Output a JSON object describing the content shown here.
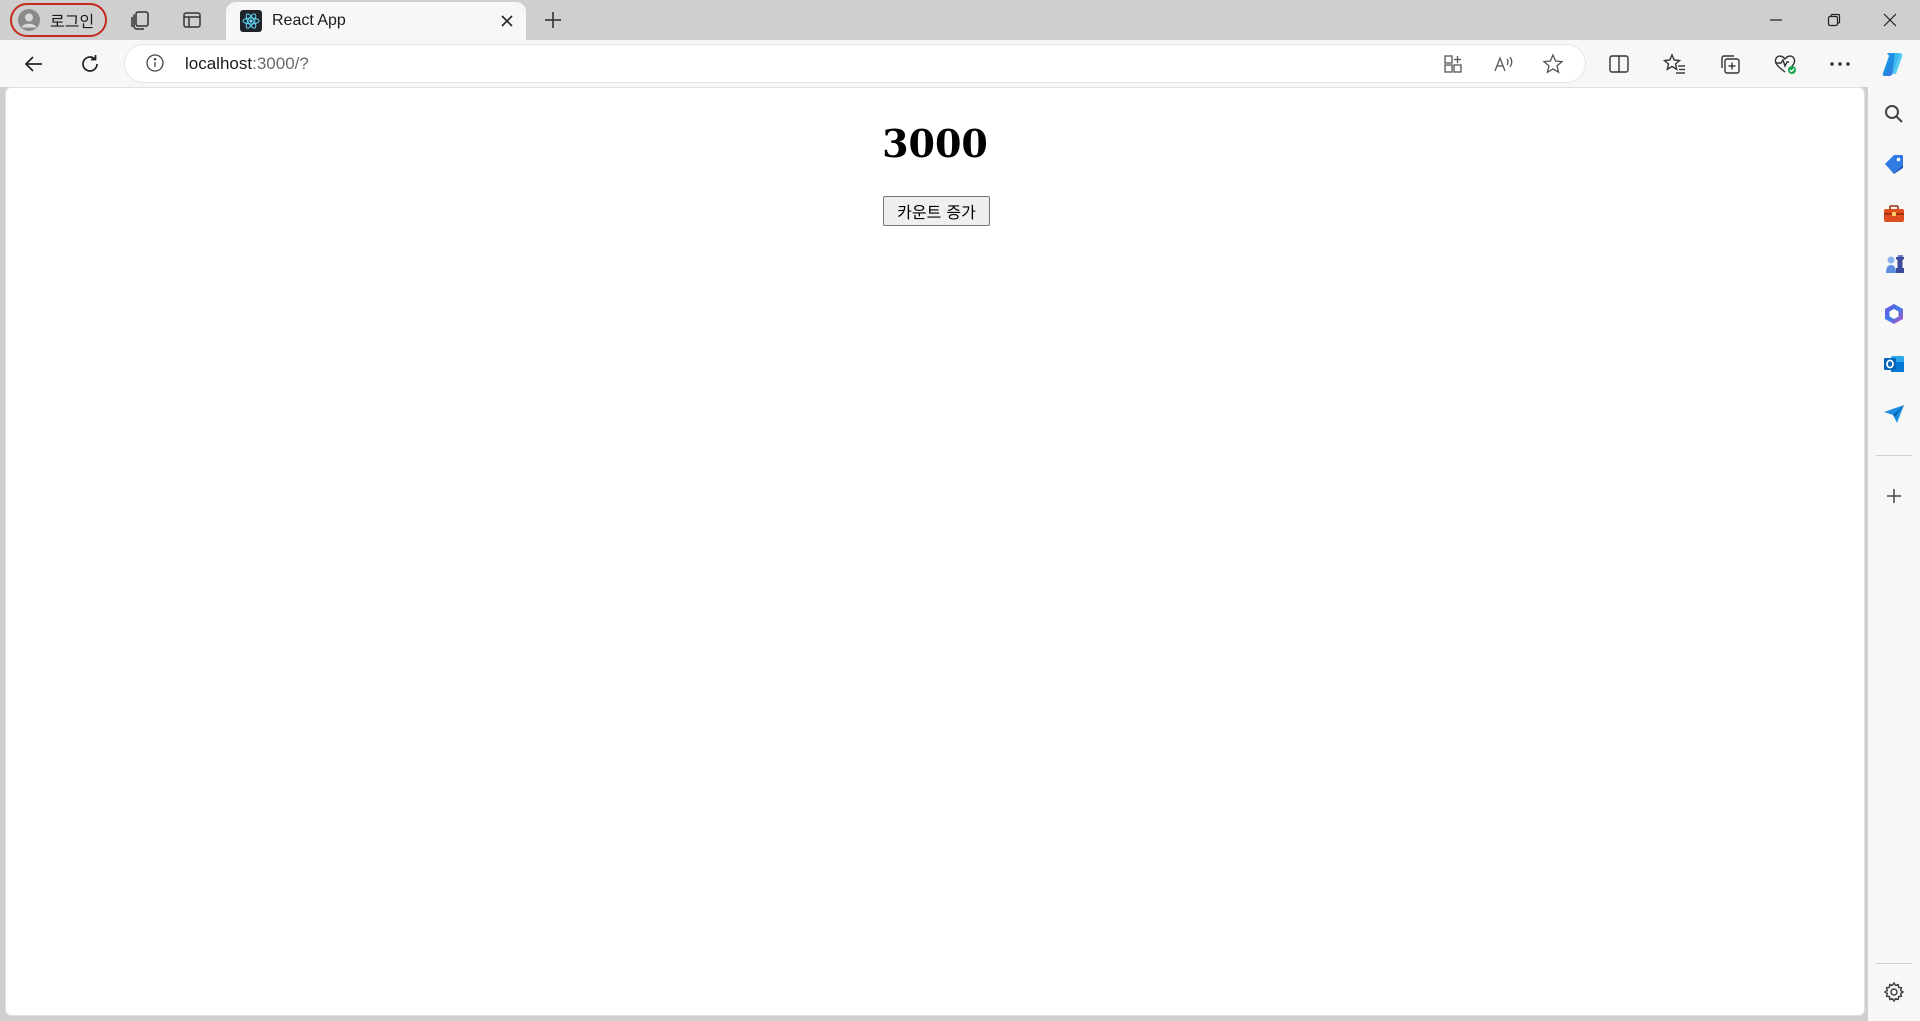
{
  "browser": {
    "profile_label": "로그인",
    "tab_title": "React App",
    "address": {
      "host": "localhost",
      "path": ":3000/?"
    }
  },
  "page": {
    "count": "3000",
    "increment_button_label": "카운트 증가"
  },
  "icons": {
    "profile": "person-icon",
    "workspaces": "workspaces-icon",
    "vertical_tabs": "tab-actions-icon",
    "favicon": "react-logo-icon",
    "close_tab": "close-icon",
    "new_tab": "plus-icon",
    "back": "back-arrow-icon",
    "refresh": "refresh-icon",
    "site_info": "info-icon",
    "app_available": "apps-icon",
    "read_aloud": "read-aloud-icon",
    "favorite": "star-icon",
    "split_screen": "split-screen-icon",
    "favorites": "favorites-icon",
    "collections": "collections-icon",
    "browser_essentials": "heart-pulse-icon",
    "more": "more-icon",
    "copilot": "copilot-icon",
    "sidebar_search": "search-icon",
    "shopping": "tag-icon",
    "tools": "toolbox-icon",
    "games": "chess-icon",
    "microsoft365": "office-icon",
    "outlook": "outlook-icon",
    "drop": "send-icon",
    "add": "plus-icon",
    "settings": "gear-icon"
  },
  "colors": {
    "profile_border": "#c42b1c",
    "react_cyan": "#61dafb",
    "copilot_blue": "#1c8adf"
  }
}
